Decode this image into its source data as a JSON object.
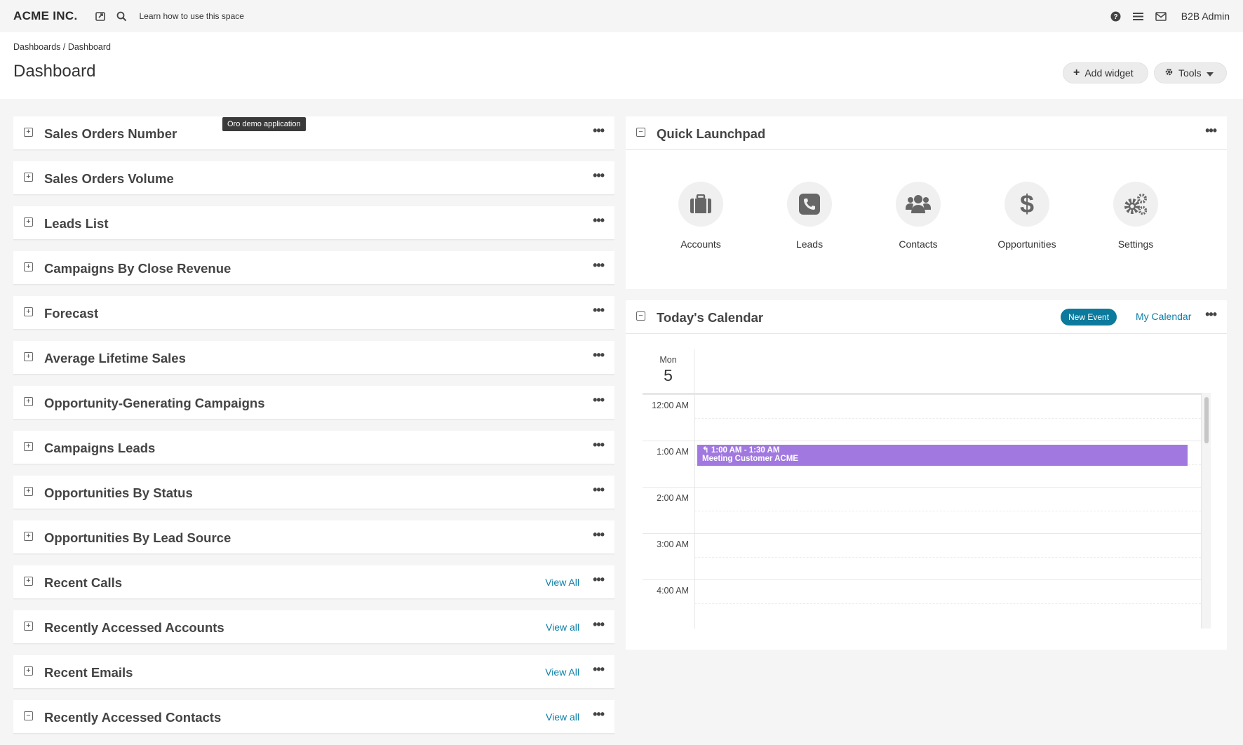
{
  "topbar": {
    "logo": "ACME INC.",
    "learn_link": "Learn how to use this space",
    "user": "B2B Admin"
  },
  "header": {
    "breadcrumb": "Dashboards / Dashboard",
    "title": "Dashboard",
    "add_widget": "Add widget",
    "tools": "Tools"
  },
  "tooltip": "Oro demo application",
  "left_widgets": [
    {
      "title": "Sales Orders Number",
      "view": ""
    },
    {
      "title": "Sales Orders Volume",
      "view": ""
    },
    {
      "title": "Leads List",
      "view": ""
    },
    {
      "title": "Campaigns By Close Revenue",
      "view": ""
    },
    {
      "title": "Forecast",
      "view": ""
    },
    {
      "title": "Average Lifetime Sales",
      "view": ""
    },
    {
      "title": "Opportunity-Generating Campaigns",
      "view": ""
    },
    {
      "title": "Campaigns Leads",
      "view": ""
    },
    {
      "title": "Opportunities By Status",
      "view": ""
    },
    {
      "title": "Opportunities By Lead Source",
      "view": ""
    },
    {
      "title": "Recent Calls",
      "view": "View All"
    },
    {
      "title": "Recently Accessed Accounts",
      "view": "View all"
    },
    {
      "title": "Recent Emails",
      "view": "View All"
    },
    {
      "title": "Recently Accessed Contacts",
      "view": "View all"
    }
  ],
  "launchpad": {
    "title": "Quick Launchpad",
    "items": [
      "Accounts",
      "Leads",
      "Contacts",
      "Opportunities",
      "Settings"
    ]
  },
  "calendar": {
    "title": "Today's Calendar",
    "new_event": "New Event",
    "my_calendar": "My Calendar",
    "day_name": "Mon",
    "day_num": "5",
    "hours": [
      "12:00 AM",
      "1:00 AM",
      "2:00 AM",
      "3:00 AM",
      "4:00 AM"
    ],
    "event": {
      "time": "1:00 AM - 1:30 AM",
      "title": "Meeting Customer ACME"
    }
  },
  "colors": {
    "accent": "#0c7a9c",
    "event": "#a178e0",
    "link": "#0a7fa7"
  }
}
